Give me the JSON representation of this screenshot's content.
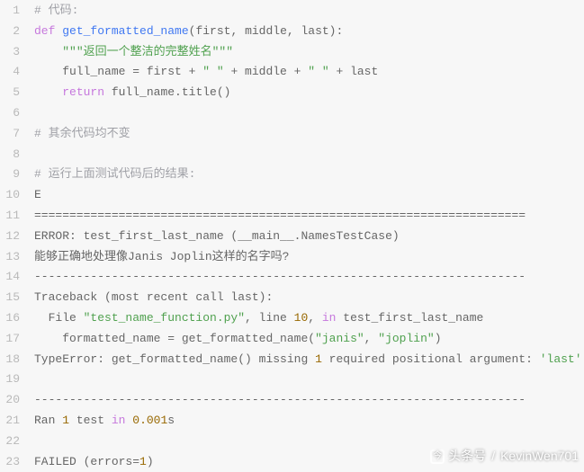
{
  "lines": [
    [
      [
        "cmt",
        "# 代码:"
      ]
    ],
    [
      [
        "kw",
        "def"
      ],
      [
        "plain",
        " "
      ],
      [
        "fn",
        "get_formatted_name"
      ],
      [
        "plain",
        "(first, middle, last):"
      ]
    ],
    [
      [
        "plain",
        "    "
      ],
      [
        "str",
        "\"\"\"返回一个整洁的完整姓名\"\"\""
      ]
    ],
    [
      [
        "plain",
        "    full_name = first + "
      ],
      [
        "str",
        "\" \""
      ],
      [
        "plain",
        " + middle + "
      ],
      [
        "str",
        "\" \""
      ],
      [
        "plain",
        " + last"
      ]
    ],
    [
      [
        "plain",
        "    "
      ],
      [
        "kw",
        "return"
      ],
      [
        "plain",
        " full_name.title()"
      ]
    ],
    [],
    [
      [
        "cmt",
        "# 其余代码均不变"
      ]
    ],
    [],
    [
      [
        "cmt",
        "# 运行上面测试代码后的结果:"
      ]
    ],
    [
      [
        "plain",
        "E"
      ]
    ],
    [
      [
        "plain",
        "======================================================================"
      ]
    ],
    [
      [
        "plain",
        "ERROR: test_first_last_name (__main__.NamesTestCase)"
      ]
    ],
    [
      [
        "plain",
        "能够正确地处理像Janis Joplin这样的名字吗?"
      ]
    ],
    [
      [
        "plain",
        "----------------------------------------------------------------------"
      ]
    ],
    [
      [
        "plain",
        "Traceback (most recent call last):"
      ]
    ],
    [
      [
        "plain",
        "  File "
      ],
      [
        "str",
        "\"test_name_function.py\""
      ],
      [
        "plain",
        ", line "
      ],
      [
        "num",
        "10"
      ],
      [
        "plain",
        ", "
      ],
      [
        "in",
        "in"
      ],
      [
        "plain",
        " test_first_last_name"
      ]
    ],
    [
      [
        "plain",
        "    formatted_name = get_formatted_name("
      ],
      [
        "str",
        "\"janis\""
      ],
      [
        "plain",
        ", "
      ],
      [
        "str",
        "\"joplin\""
      ],
      [
        "plain",
        ")"
      ]
    ],
    [
      [
        "plain",
        "TypeError: get_formatted_name() missing "
      ],
      [
        "num",
        "1"
      ],
      [
        "plain",
        " required positional argument: "
      ],
      [
        "str",
        "'last'"
      ]
    ],
    [],
    [
      [
        "plain",
        "----------------------------------------------------------------------"
      ]
    ],
    [
      [
        "plain",
        "Ran "
      ],
      [
        "num",
        "1"
      ],
      [
        "plain",
        " test "
      ],
      [
        "in",
        "in"
      ],
      [
        "plain",
        " "
      ],
      [
        "num",
        "0.001"
      ],
      [
        "plain",
        "s"
      ]
    ],
    [],
    [
      [
        "plain",
        "FAILED (errors="
      ],
      [
        "num",
        "1"
      ],
      [
        "plain",
        ")"
      ]
    ]
  ],
  "watermark": {
    "icon_glyph": "今",
    "label1": "头条号",
    "sep": "/",
    "label2": "KevinWen701"
  }
}
